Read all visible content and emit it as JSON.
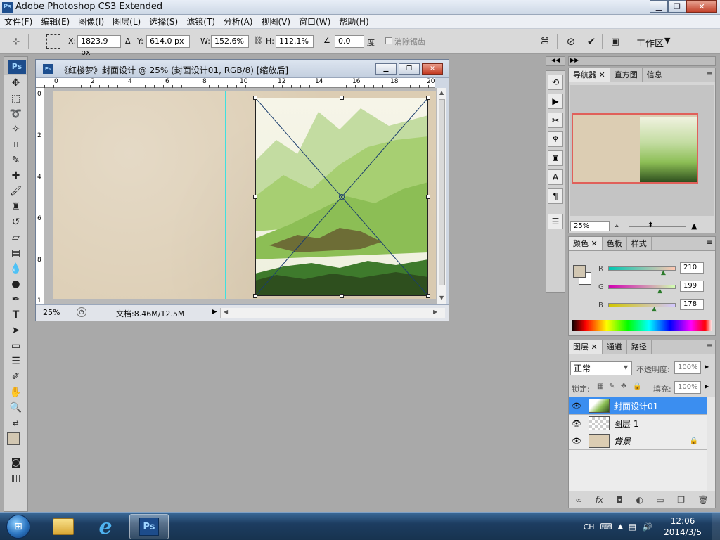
{
  "app": {
    "title": "Adobe Photoshop CS3 Extended",
    "icon": "Ps"
  },
  "menu": [
    "文件(F)",
    "编辑(E)",
    "图像(I)",
    "图层(L)",
    "选择(S)",
    "滤镜(T)",
    "分析(A)",
    "视图(V)",
    "窗口(W)",
    "帮助(H)"
  ],
  "options": {
    "x_label": "X:",
    "x_value": "1823.9 px",
    "y_label": "Y:",
    "y_value": "614.0 px",
    "w_label": "W:",
    "w_value": "152.6%",
    "h_label": "H:",
    "h_value": "112.1%",
    "rotate_value": "0.0",
    "rotate_unit": "度",
    "antialias_label": "消除锯齿",
    "workspace_label": "工作区"
  },
  "document": {
    "title": "《红楼梦》封面设计 @ 25% (封面设计01, RGB/8) [缩放后]",
    "zoom": "25%",
    "doc_info": "文档:8.46M/12.5M",
    "hruler_labels": [
      "0",
      "2",
      "4",
      "6",
      "8",
      "10",
      "12",
      "14",
      "16",
      "18",
      "20"
    ],
    "vruler_labels": [
      "0",
      "2",
      "4",
      "6",
      "8",
      "1"
    ],
    "canvas_color": "#dccdb3"
  },
  "navigator": {
    "tabs": [
      "导航器",
      "直方图",
      "信息"
    ],
    "zoom": "25%"
  },
  "color_panel": {
    "tabs": [
      "颜色",
      "色板",
      "样式"
    ],
    "r_label": "R",
    "r_value": "210",
    "g_label": "G",
    "g_value": "199",
    "b_label": "B",
    "b_value": "178",
    "foreground": "#d2c7b2"
  },
  "layers_panel": {
    "tabs": [
      "图层",
      "通道",
      "路径"
    ],
    "blend_mode": "正常",
    "opacity_label": "不透明度:",
    "opacity_value": "100%",
    "lock_label": "锁定:",
    "fill_label": "填充:",
    "fill_value": "100%",
    "layers": [
      {
        "name": "封面设计01",
        "selected": true
      },
      {
        "name": "图层 1",
        "selected": false
      },
      {
        "name": "背景",
        "selected": false
      }
    ]
  },
  "taskbar": {
    "lang": "CH",
    "time": "12:06",
    "date": "2014/3/5",
    "ps_icon": "Ps"
  }
}
